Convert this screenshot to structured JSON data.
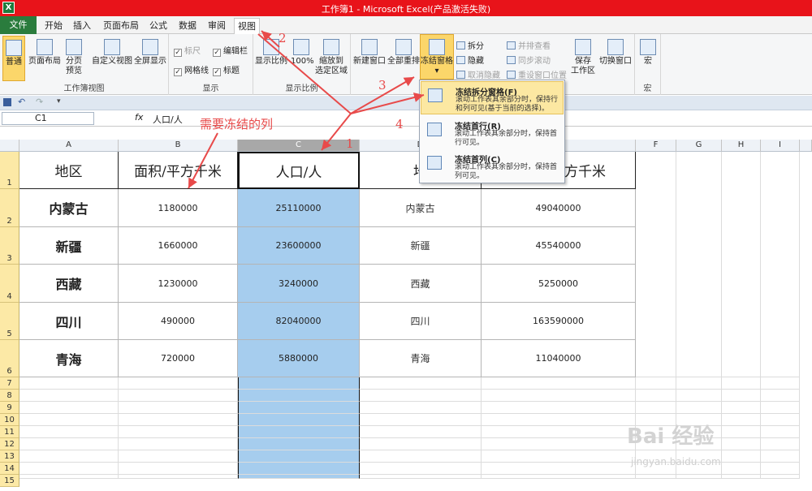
{
  "window": {
    "title": "工作簿1 - Microsoft Excel(产品激活失败)",
    "app_icon": "X"
  },
  "tabs": [
    "文件",
    "开始",
    "插入",
    "页面布局",
    "公式",
    "数据",
    "审阅",
    "视图"
  ],
  "ribbon": {
    "views": {
      "normal": "普通",
      "page_layout": "页面布局",
      "page_break": "分页\n预览",
      "custom": "自定义视图",
      "full": "全屏显示",
      "label": "工作簿视图"
    },
    "show": {
      "ruler": "标尺",
      "formula_bar": "编辑栏",
      "gridlines": "网格线",
      "headings": "标题",
      "label": "显示"
    },
    "zoom": {
      "zoom": "显示比例",
      "zoom100": "100%",
      "zoom_sel": "缩放到\n选定区域",
      "label": "显示比例"
    },
    "window": {
      "new": "新建窗口",
      "arrange": "全部重排",
      "freeze": "冻结窗格",
      "split": "拆分",
      "hide": "隐藏",
      "unhide": "取消隐藏",
      "side": "并排查看",
      "sync": "同步滚动",
      "reset": "重设窗口位置",
      "save_ws": "保存\n工作区",
      "switch": "切换窗口"
    },
    "macros": {
      "macro": "宏",
      "label": "宏"
    }
  },
  "formula": {
    "namebox": "C1",
    "fx": "fx",
    "value": "人口/人"
  },
  "columns": [
    "A",
    "B",
    "C",
    "D",
    "E",
    "F",
    "G",
    "H",
    "I"
  ],
  "rows": [
    "1",
    "2",
    "3",
    "4",
    "5",
    "6",
    "7",
    "8",
    "9",
    "10",
    "11",
    "12",
    "13",
    "14",
    "15"
  ],
  "sheet": {
    "header": [
      "地区",
      "面积/平方千米",
      "人口/人",
      "地",
      "方千米"
    ],
    "data": [
      [
        "内蒙古",
        "1180000",
        "25110000",
        "内蒙古",
        "49040000"
      ],
      [
        "新疆",
        "1660000",
        "23600000",
        "新疆",
        "45540000"
      ],
      [
        "西藏",
        "1230000",
        "3240000",
        "西藏",
        "5250000"
      ],
      [
        "四川",
        "490000",
        "82040000",
        "四川",
        "163590000"
      ],
      [
        "青海",
        "720000",
        "5880000",
        "青海",
        "11040000"
      ]
    ]
  },
  "freeze_menu": [
    {
      "title": "冻结拆分窗格(F)",
      "desc": "滚动工作表其余部分时，保持行和列可见(基于当前的选择)。"
    },
    {
      "title": "冻结首行(R)",
      "desc": "滚动工作表其余部分时，保持首行可见。"
    },
    {
      "title": "冻结首列(C)",
      "desc": "滚动工作表其余部分时，保持首列可见。"
    }
  ],
  "annotations": {
    "label": "需要冻结的列",
    "n1": "1",
    "n2": "2",
    "n3": "3",
    "n4": "4",
    "color": "#e84a4a"
  },
  "watermark": {
    "main": "Bai 经验",
    "sub": "jingyan.baidu.com"
  },
  "colors": {
    "title": "#e8131a",
    "file_tab": "#2a7c3d",
    "selection": "#a6cdee",
    "menu_highlight": "#fce8a2"
  }
}
